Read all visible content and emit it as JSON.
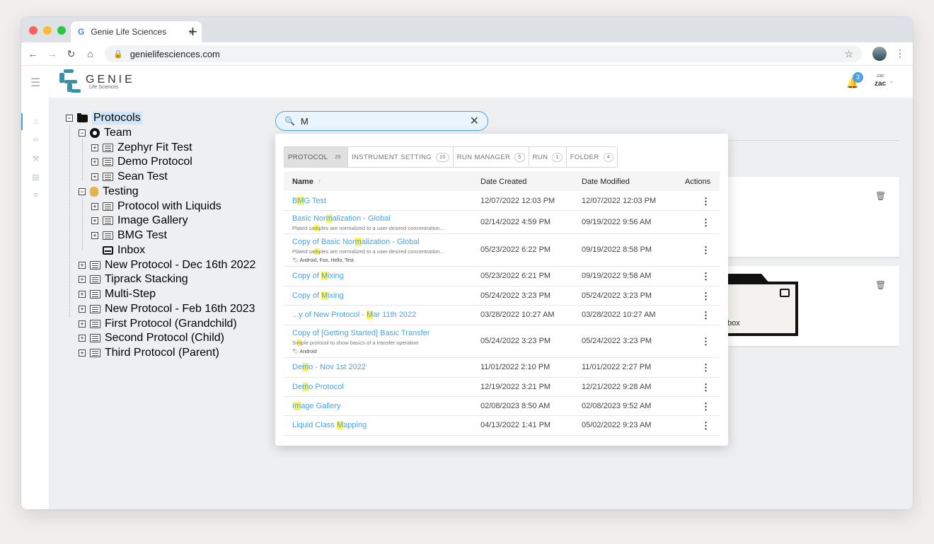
{
  "browser": {
    "tab_title": "Genie Life Sciences",
    "tab_close": "×",
    "new_tab": "+",
    "url": "genielifesciences.com",
    "nav": {
      "back": "←",
      "forward": "→",
      "reload": "↻",
      "home": "⌂"
    },
    "star": "☆",
    "menu": "⋮"
  },
  "app": {
    "brand": "GENIE",
    "brand_sub": "Life Sciences",
    "notification_count": "3",
    "user_small": "zac",
    "user_name": "zac"
  },
  "tree": {
    "root": "Protocols",
    "team": "Team",
    "team_items": [
      "Zephyr Fit Test",
      "Demo Protocol",
      "Sean Test"
    ],
    "testing": "Testing",
    "testing_items": [
      "Protocol with Liquids",
      "Image Gallery",
      "BMG Test"
    ],
    "inbox": "Inbox",
    "root_items": [
      "New Protocol - Dec 16th 2022",
      "Tiprack Stacking",
      "Multi-Step",
      "New Protocol - Feb 16th 2023",
      "First Protocol (Grandchild)",
      "Second Protocol (Child)",
      "Third Protocol (Parent)"
    ]
  },
  "search": {
    "value": "M"
  },
  "background": {
    "folder_label": "box"
  },
  "popup": {
    "tabs": [
      {
        "label": "PROTOCOL",
        "count": "20"
      },
      {
        "label": "INSTRUMENT SETTING",
        "count": "10"
      },
      {
        "label": "RUN MANAGER",
        "count": "5"
      },
      {
        "label": "RUN",
        "count": "1"
      },
      {
        "label": "FOLDER",
        "count": "4"
      }
    ],
    "columns": {
      "name": "Name",
      "sort_icon": "↑",
      "created": "Date Created",
      "modified": "Date Modified",
      "actions": "Actions"
    },
    "rows": [
      {
        "name": [
          "B",
          "M",
          "G Test"
        ],
        "created": "12/07/2022 12:03 PM",
        "modified": "12/07/2022 12:03 PM"
      },
      {
        "name": [
          "Basic Nor",
          "m",
          "alization - Global"
        ],
        "desc": [
          "Plated sa",
          "m",
          "ples are normalized to a user-desired concentration..."
        ],
        "created": "02/14/2022 4:59 PM",
        "modified": "09/19/2022 9:56 AM"
      },
      {
        "name": [
          "Copy of Basic Nor",
          "m",
          "alization - Global"
        ],
        "desc": [
          "Plated sa",
          "m",
          "ples are normalized to a user-desired concentration..."
        ],
        "tags": "Android, Foo, Hello, Test",
        "created": "05/23/2022 6:22 PM",
        "modified": "09/19/2022 8:58 PM"
      },
      {
        "name": [
          "Copy of ",
          "M",
          "ixing"
        ],
        "created": "05/23/2022 6:21 PM",
        "modified": "09/19/2022 9:58 AM"
      },
      {
        "name": [
          "Copy of ",
          "M",
          "ixing"
        ],
        "created": "05/24/2022 3:23 PM",
        "modified": "05/24/2022 3:23 PM"
      },
      {
        "name": [
          "...y of New Protocol - ",
          "M",
          "ar 11th 2022"
        ],
        "created": "03/28/2022 10:27 AM",
        "modified": "03/28/2022 10:27 AM"
      },
      {
        "name": [
          "Copy of [Getting Started] Basic Transfer",
          "",
          ""
        ],
        "desc": [
          "Si",
          "m",
          "ple protocol to show basics of a transfer operation"
        ],
        "tags": "Android",
        "created": "05/24/2022 3:23 PM",
        "modified": "05/24/2022 3:23 PM"
      },
      {
        "name": [
          "De",
          "m",
          "o - Nov 1st 2022"
        ],
        "created": "11/01/2022 2:10 PM",
        "modified": "11/01/2022 2:27 PM"
      },
      {
        "name": [
          "De",
          "m",
          "o Protocol"
        ],
        "created": "12/19/2022 3:21 PM",
        "modified": "12/21/2022 9:28 AM"
      },
      {
        "name": [
          "I",
          "m",
          "age Gallery"
        ],
        "created": "02/08/2023 8:50 AM",
        "modified": "02/08/2023 9:52 AM"
      },
      {
        "name": [
          "Liquid Class ",
          "M",
          "apping"
        ],
        "created": "04/13/2022 1:41 PM",
        "modified": "05/02/2022 9:23 AM"
      }
    ]
  },
  "colors": {
    "accent": "#4ba3e3",
    "highlight": "#f8f26b",
    "logo": "#3b8fa8"
  }
}
